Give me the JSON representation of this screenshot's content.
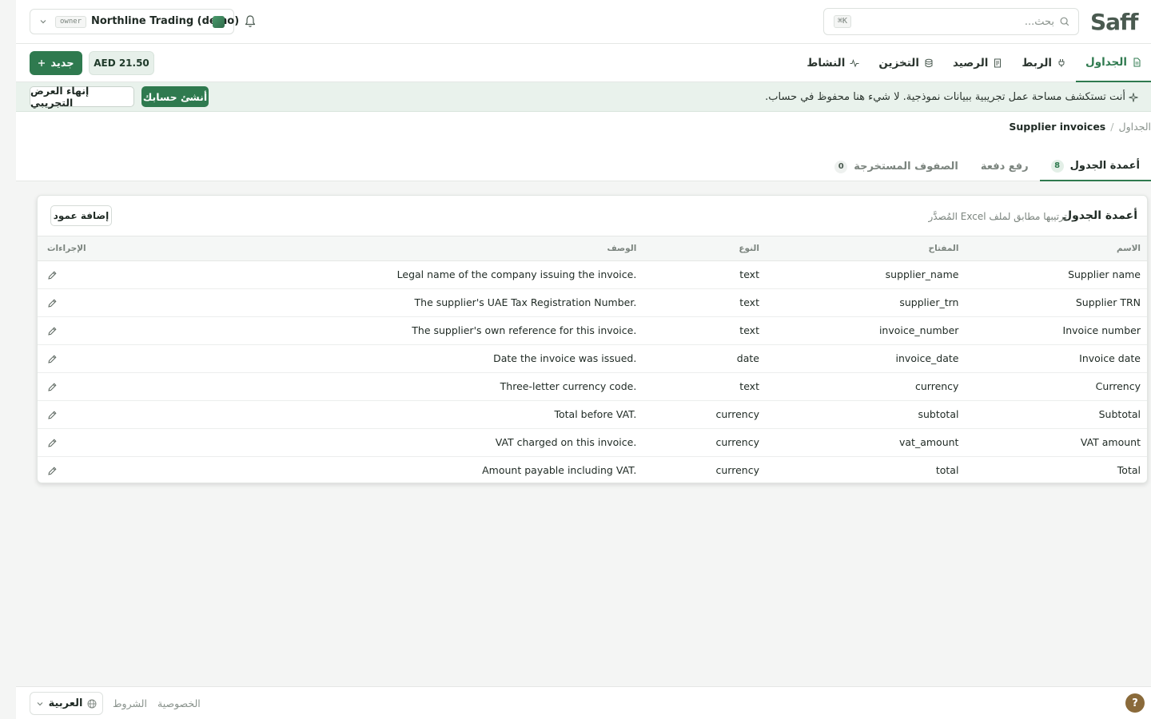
{
  "brand": {
    "logo_text": "Saff"
  },
  "search": {
    "placeholder": "بحث...",
    "shortcut": "⌘K"
  },
  "org": {
    "role_badge": "owner",
    "name": "Northline Trading (demo)"
  },
  "nav": {
    "tabs": [
      {
        "label": "الجداول",
        "icon": "file-icon",
        "active": true
      },
      {
        "label": "الربط",
        "icon": "plug-icon",
        "active": false
      },
      {
        "label": "الرصيد",
        "icon": "receipt-icon",
        "active": false
      },
      {
        "label": "التخزين",
        "icon": "database-icon",
        "active": false
      },
      {
        "label": "النشاط",
        "icon": "activity-icon",
        "active": false
      }
    ],
    "balance": "AED 21.50",
    "new_label": "جديد"
  },
  "banner": {
    "text": "أنت تستكشف مساحة عمل تجريبية ببيانات نموذجية. لا شيء هنا محفوظ في حساب.",
    "create_label": "أنشئ حسابك",
    "end_label": "إنهاء العرض التجريبي"
  },
  "breadcrumb": {
    "root": "الجداول",
    "separator": "/",
    "current": "Supplier invoices"
  },
  "sub_tabs": [
    {
      "label": "أعمدة الجدول",
      "count": "8",
      "active": true
    },
    {
      "label": "رفع دفعة",
      "count": null,
      "active": false
    },
    {
      "label": "الصفوف المستخرجة",
      "count": "0",
      "active": false
    }
  ],
  "card": {
    "title": "أعمدة الجدول",
    "subtitle": "ترتيبها مطابق لملف Excel المُصدَّر",
    "add_label": "إضافة عمود",
    "headers": {
      "name": "الاسم",
      "key": "المفتاح",
      "type": "النوع",
      "desc": "الوصف",
      "actions": "الإجراءات"
    },
    "rows": [
      {
        "name": "Supplier name",
        "key": "supplier_name",
        "type": "text",
        "desc": "Legal name of the company issuing the invoice."
      },
      {
        "name": "Supplier TRN",
        "key": "supplier_trn",
        "type": "text",
        "desc": "The supplier's UAE Tax Registration Number."
      },
      {
        "name": "Invoice number",
        "key": "invoice_number",
        "type": "text",
        "desc": "The supplier's own reference for this invoice."
      },
      {
        "name": "Invoice date",
        "key": "invoice_date",
        "type": "date",
        "desc": "Date the invoice was issued."
      },
      {
        "name": "Currency",
        "key": "currency",
        "type": "text",
        "desc": "Three-letter currency code."
      },
      {
        "name": "Subtotal",
        "key": "subtotal",
        "type": "currency",
        "desc": "Total before VAT."
      },
      {
        "name": "VAT amount",
        "key": "vat_amount",
        "type": "currency",
        "desc": "VAT charged on this invoice."
      },
      {
        "name": "Total",
        "key": "total",
        "type": "currency",
        "desc": "Amount payable including VAT."
      }
    ]
  },
  "footer": {
    "language": "العربية",
    "terms": "الشروط",
    "privacy": "الخصوصية",
    "help": "?"
  },
  "colors": {
    "accent": "#2f7a4f",
    "banner_bg": "#e9f2ec",
    "help_bg": "#8a6a3a"
  }
}
